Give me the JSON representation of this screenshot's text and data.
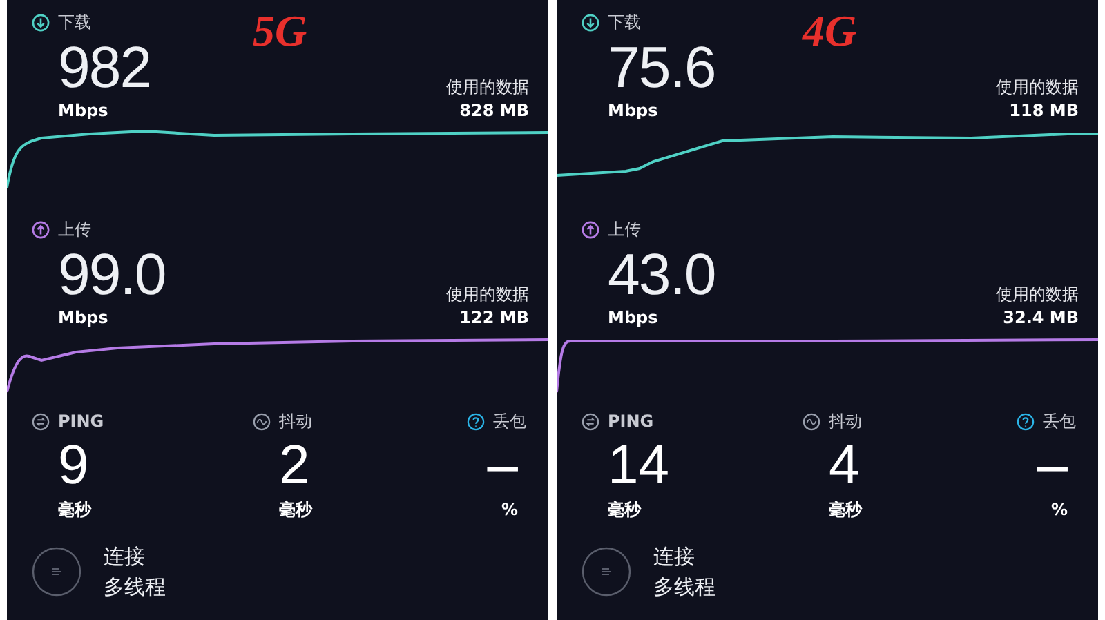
{
  "panels": [
    {
      "network_label": "5G",
      "download": {
        "label": "下载",
        "value": "982",
        "unit": "Mbps",
        "data_label": "使用的数据",
        "data_value": "828 MB"
      },
      "upload": {
        "label": "上传",
        "value": "99.0",
        "unit": "Mbps",
        "data_label": "使用的数据",
        "data_value": "122 MB"
      },
      "metrics": [
        {
          "kind": "ping",
          "label": "PING",
          "value": "9",
          "unit": "毫秒"
        },
        {
          "kind": "jitter",
          "label": "抖动",
          "value": "2",
          "unit": "毫秒"
        },
        {
          "kind": "loss",
          "label": "丢包",
          "value": "–",
          "unit": "%"
        }
      ],
      "connection": {
        "label": "连接",
        "value": "多线程"
      }
    },
    {
      "network_label": "4G",
      "download": {
        "label": "下载",
        "value": "75.6",
        "unit": "Mbps",
        "data_label": "使用的数据",
        "data_value": "118 MB"
      },
      "upload": {
        "label": "上传",
        "value": "43.0",
        "unit": "Mbps",
        "data_label": "使用的数据",
        "data_value": "32.4 MB"
      },
      "metrics": [
        {
          "kind": "ping",
          "label": "PING",
          "value": "14",
          "unit": "毫秒"
        },
        {
          "kind": "jitter",
          "label": "抖动",
          "value": "4",
          "unit": "毫秒"
        },
        {
          "kind": "loss",
          "label": "丢包",
          "value": "–",
          "unit": "%"
        }
      ],
      "connection": {
        "label": "连接",
        "value": "多线程"
      }
    }
  ]
}
